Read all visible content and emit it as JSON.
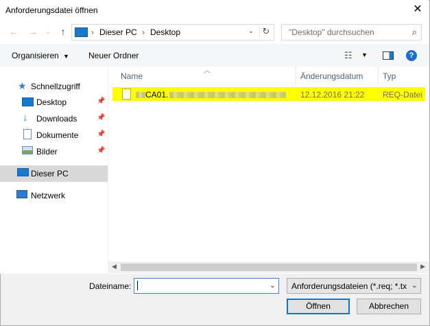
{
  "window": {
    "title": "Anforderungsdatei öffnen"
  },
  "address": {
    "crumbs": [
      "Dieser PC",
      "Desktop"
    ],
    "separator": "›"
  },
  "search": {
    "placeholder": "\"Desktop\" durchsuchen"
  },
  "toolbar": {
    "organize": "Organisieren",
    "new_folder": "Neuer Ordner"
  },
  "sidebar": {
    "items": [
      {
        "label": "Schnellzugriff",
        "icon": "star-icon",
        "pinned": false
      },
      {
        "label": "Desktop",
        "icon": "desktop-icon",
        "pinned": true
      },
      {
        "label": "Downloads",
        "icon": "download-icon",
        "pinned": true
      },
      {
        "label": "Dokumente",
        "icon": "document-icon",
        "pinned": true
      },
      {
        "label": "Bilder",
        "icon": "pictures-icon",
        "pinned": true
      },
      {
        "label": "Dieser PC",
        "icon": "pc-icon",
        "selected": true
      },
      {
        "label": "Netzwerk",
        "icon": "network-icon"
      }
    ]
  },
  "columns": {
    "name": "Name",
    "date": "Änderungsdatum",
    "type": "Typ"
  },
  "files": [
    {
      "name_visible": "CA01.",
      "date": "12.12.2016 21:22",
      "type": "REQ-Datei",
      "highlight": "#ffff00"
    }
  ],
  "footer": {
    "filename_label": "Dateiname:",
    "filename_value": "",
    "filter": "Anforderungsdateien (*.req; *.txt)",
    "open": "Öffnen",
    "cancel": "Abbrechen"
  },
  "colors": {
    "accent": "#0078d7",
    "selected_bg": "#d9d9d9",
    "highlight": "#ffff00"
  }
}
